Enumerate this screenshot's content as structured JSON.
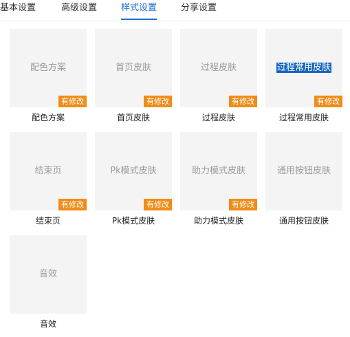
{
  "tabs": [
    {
      "label": "基本设置",
      "active": false
    },
    {
      "label": "高级设置",
      "active": false
    },
    {
      "label": "样式设置",
      "active": true
    },
    {
      "label": "分享设置",
      "active": false
    }
  ],
  "colors": {
    "accent": "#1f6fd1",
    "badge": "#f08c1a",
    "thumb_bg": "#f4f4f4",
    "selection": "#1565c0"
  },
  "cards": [
    {
      "thumb_text": "配色方案",
      "badge": "有修改",
      "caption": "配色方案"
    },
    {
      "thumb_text": "首页皮肤",
      "badge": "有修改",
      "caption": "首页皮肤"
    },
    {
      "thumb_text": "过程皮肤",
      "badge": "有修改",
      "caption": "过程皮肤"
    },
    {
      "thumb_text": "过程常用皮肤",
      "badge": "有修改",
      "caption": "过程常用皮肤",
      "text_selected": true
    },
    {
      "thumb_text": "结束页",
      "badge": "有修改",
      "caption": "结束页"
    },
    {
      "thumb_text": "Pk模式皮肤",
      "badge": "有修改",
      "caption": "Pk模式皮肤"
    },
    {
      "thumb_text": "助力模式皮肤",
      "badge": "有修改",
      "caption": "助力模式皮肤"
    },
    {
      "thumb_text": "通用按钮皮肤",
      "badge": "",
      "caption": "通用按钮皮肤"
    },
    {
      "thumb_text": "音效",
      "badge": "",
      "caption": "音效"
    }
  ]
}
